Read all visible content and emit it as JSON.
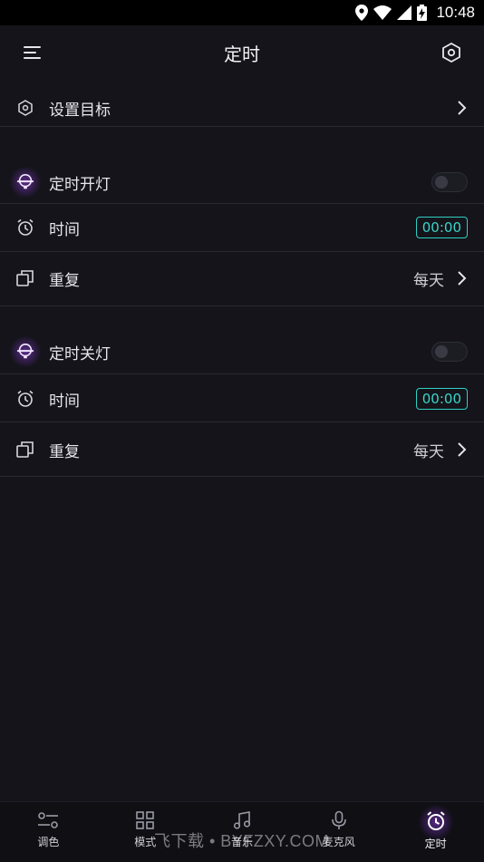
{
  "status": {
    "time": "10:48"
  },
  "header": {
    "title": "定时"
  },
  "target_row": {
    "label": "设置目标"
  },
  "timer_on": {
    "label": "定时开灯",
    "time_label": "时间",
    "time_value": "00:00",
    "repeat_label": "重复",
    "repeat_value": "每天"
  },
  "timer_off": {
    "label": "定时关灯",
    "time_label": "时间",
    "time_value": "00:00",
    "repeat_label": "重复",
    "repeat_value": "每天"
  },
  "nav": {
    "items": [
      {
        "label": "调色",
        "icon": "sliders-icon"
      },
      {
        "label": "模式",
        "icon": "grid-icon"
      },
      {
        "label": "音乐",
        "icon": "music-note-icon"
      },
      {
        "label": "麦克风",
        "icon": "microphone-icon"
      },
      {
        "label": "定时",
        "icon": "alarm-clock-icon",
        "active": true
      }
    ]
  },
  "watermark": "飞下载 • BYFZXY.COM",
  "colors": {
    "accent": "#39d6c9",
    "background": "#14141a",
    "glow": "#963ce6"
  }
}
